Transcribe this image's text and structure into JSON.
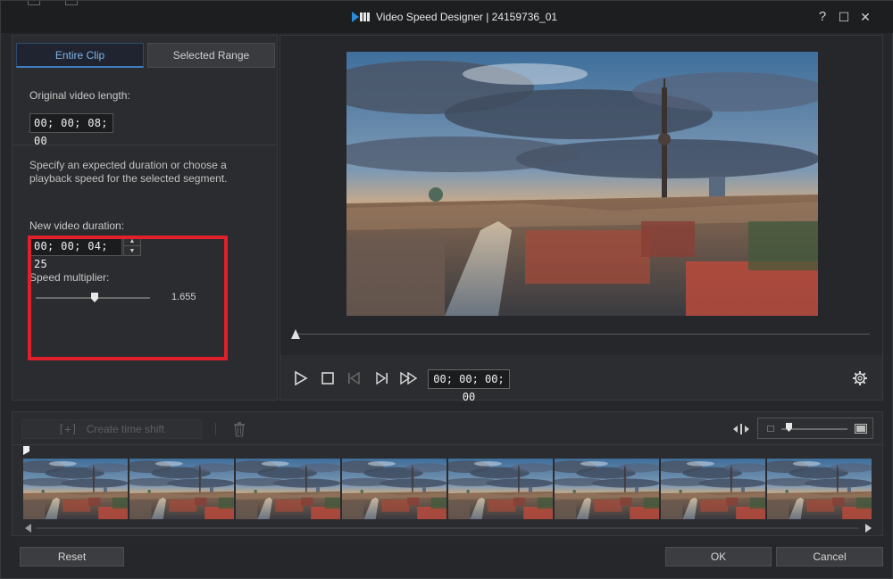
{
  "window": {
    "title": "Video Speed Designer  |  24159736_01",
    "help_glyph": "?",
    "maximize_glyph": "☐",
    "close_glyph": "✕",
    "logo_icon": "video-speed-logo-icon"
  },
  "left_panel": {
    "tabs": [
      {
        "label": "Entire Clip",
        "active": true
      },
      {
        "label": "Selected Range",
        "active": false
      }
    ],
    "original_length_label": "Original video length:",
    "original_length_value": "00; 00; 08; 00",
    "description": "Specify an expected duration or choose a playback speed for the selected segment.",
    "new_duration_label": "New video duration:",
    "new_duration_value": "00; 00; 04; 25",
    "spin_up": "▲",
    "spin_down": "▼",
    "speed_multiplier_label": "Speed multiplier:",
    "speed_multiplier_value": "1.655",
    "highlight_color": "#e0202b"
  },
  "preview": {
    "timecode": "00; 00; 00; 00",
    "controls": [
      "play-icon",
      "stop-icon",
      "previous-frame-icon",
      "next-frame-icon",
      "fast-forward-icon",
      "settings-gear-icon"
    ]
  },
  "timeline": {
    "create_time_shift_label": "Create time shift",
    "create_time_shift_glyph": "[+]",
    "frame_count": 8
  },
  "buttons": {
    "reset": "Reset",
    "ok": "OK",
    "cancel": "Cancel"
  },
  "colors": {
    "accent": "#3f7cc4",
    "background": "#26272a"
  }
}
